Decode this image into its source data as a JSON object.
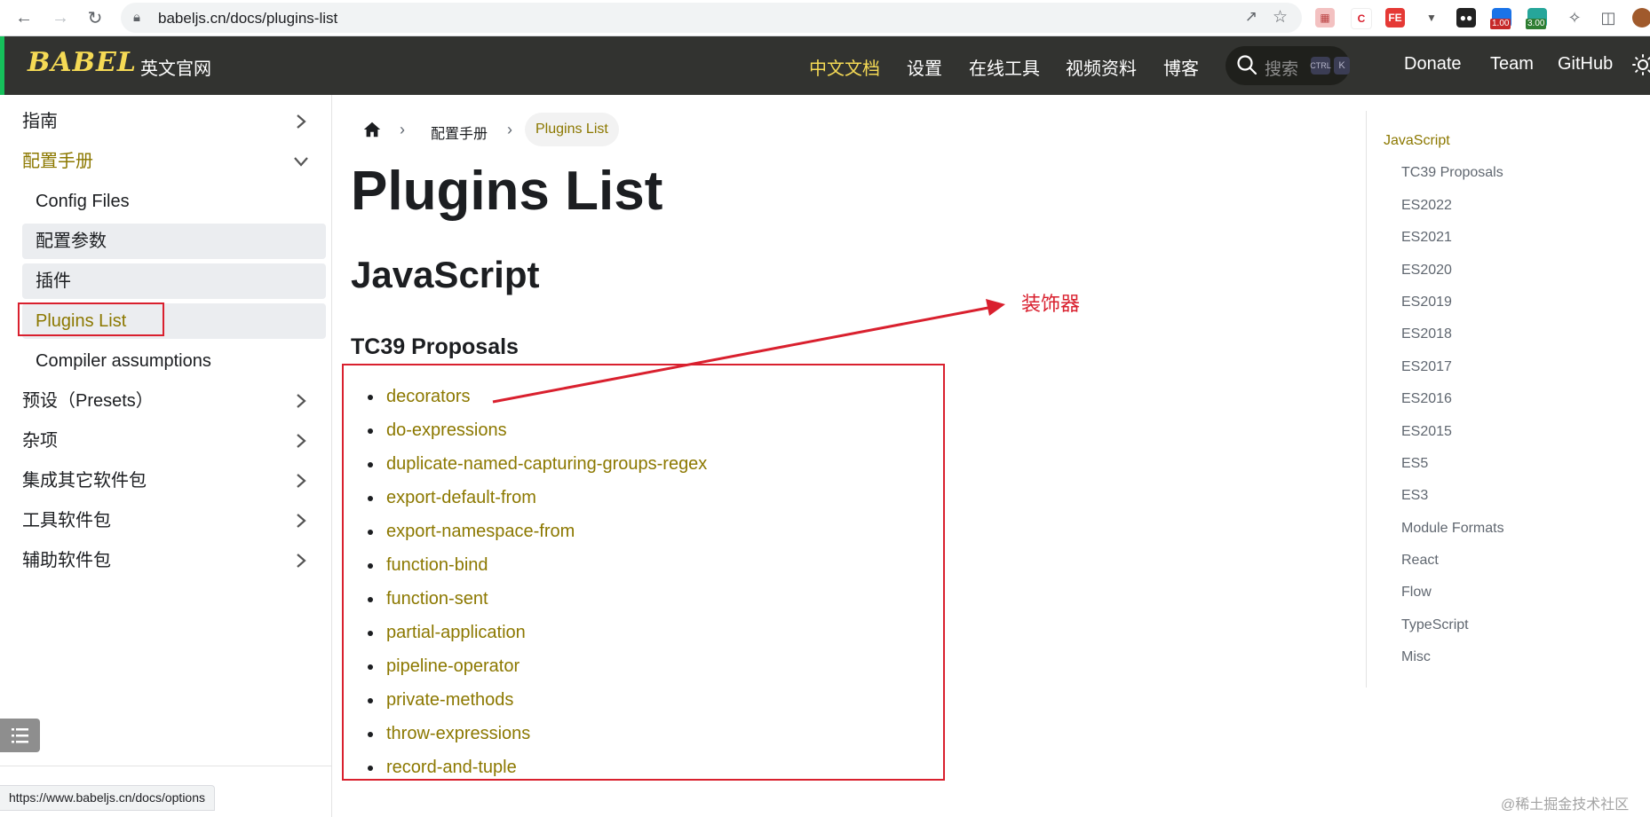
{
  "browser": {
    "url": "babeljs.cn/docs/plugins-list",
    "ext_badges": [
      "1.00",
      "3.00"
    ],
    "status_url": "https://www.babeljs.cn/docs/options"
  },
  "navbar": {
    "logo": "BABEL",
    "left_link": "英文官网",
    "items": [
      "中文文档",
      "设置",
      "在线工具",
      "视频资料",
      "博客"
    ],
    "search_placeholder": "搜索",
    "search_keys": [
      "CTRL",
      "K"
    ],
    "right_items": [
      "Donate",
      "Team",
      "GitHub"
    ],
    "colors": {
      "background": "#323330",
      "accent": "#f5da55"
    }
  },
  "sidebar": {
    "items": [
      {
        "label": "指南"
      },
      {
        "label": "配置手册"
      },
      {
        "label": "Config Files"
      },
      {
        "label": "配置参数"
      },
      {
        "label": "插件"
      },
      {
        "label": "Plugins List"
      },
      {
        "label": "Compiler assumptions"
      },
      {
        "label": "预设（Presets）"
      },
      {
        "label": "杂项"
      },
      {
        "label": "集成其它软件包"
      },
      {
        "label": "工具软件包"
      },
      {
        "label": "辅助软件包"
      }
    ]
  },
  "breadcrumb": {
    "items": [
      "配置手册",
      "Plugins List"
    ]
  },
  "content": {
    "title": "Plugins List",
    "section": "JavaScript",
    "subsection": "TC39 Proposals",
    "plugins": [
      "decorators",
      "do-expressions",
      "duplicate-named-capturing-groups-regex",
      "export-default-from",
      "export-namespace-from",
      "function-bind",
      "function-sent",
      "partial-application",
      "pipeline-operator",
      "private-methods",
      "throw-expressions",
      "record-and-tuple"
    ],
    "link_color": "#8c7800"
  },
  "annotation": {
    "label": "装饰器",
    "color": "#d9202e"
  },
  "toc": {
    "items": [
      "JavaScript",
      "TC39 Proposals",
      "ES2022",
      "ES2021",
      "ES2020",
      "ES2019",
      "ES2018",
      "ES2017",
      "ES2016",
      "ES2015",
      "ES5",
      "ES3",
      "Module Formats",
      "React",
      "Flow",
      "TypeScript",
      "Misc"
    ]
  },
  "watermark": "@稀土掘金技术社区"
}
